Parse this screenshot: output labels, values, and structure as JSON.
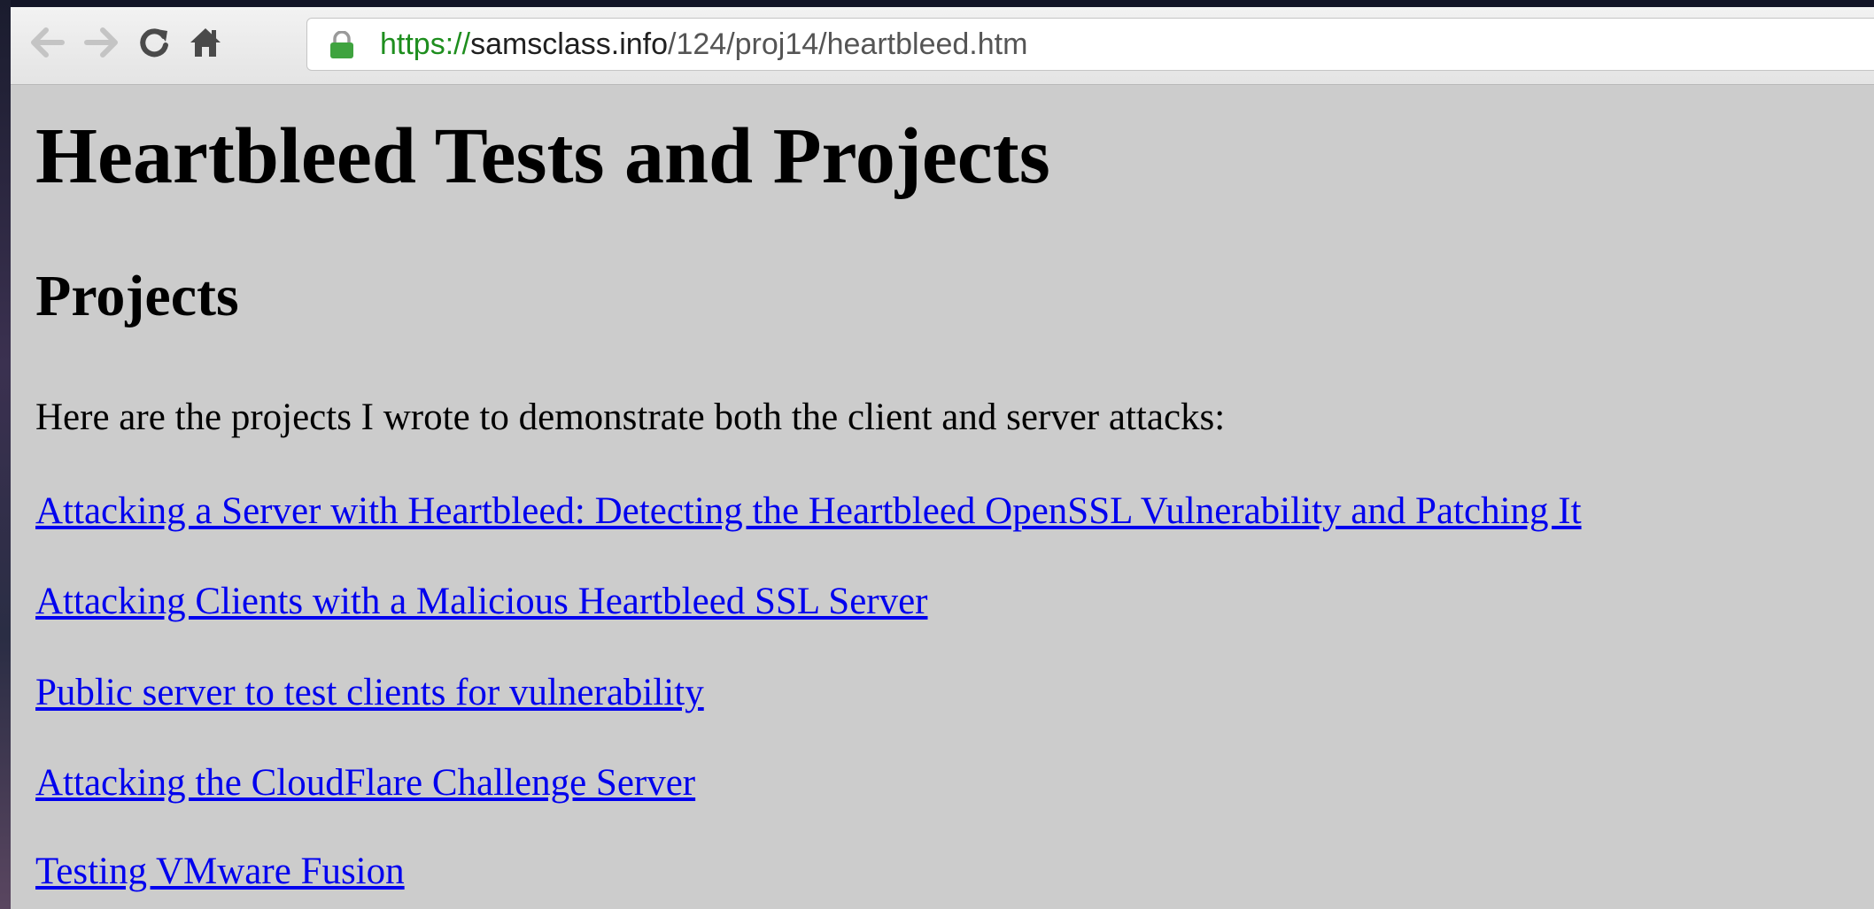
{
  "browser": {
    "url": {
      "scheme": "https",
      "separator": "://",
      "host": "samsclass.info",
      "path": "/124/proj14/heartbleed.htm"
    },
    "icons": {
      "back": "back-arrow-icon",
      "forward": "forward-arrow-icon",
      "reload": "reload-icon",
      "home": "home-icon",
      "secure": "lock-icon"
    },
    "colors": {
      "secure_green": "#1e8e1e",
      "lock_green": "#3fa33f"
    }
  },
  "page": {
    "title": "Heartbleed Tests and Projects",
    "section_heading": "Projects",
    "intro": "Here are the projects I wrote to demonstrate both the client and server attacks:",
    "links": [
      "Attacking a Server with Heartbleed: Detecting the Heartbleed OpenSSL Vulnerability and Patching It",
      "Attacking Clients with a Malicious Heartbleed SSL Server",
      "Public server to test clients for vulnerability",
      "Attacking the CloudFlare Challenge Server",
      "Testing VMware Fusion"
    ],
    "colors": {
      "background": "#cccccc",
      "link": "#0000ee",
      "text": "#000000"
    }
  }
}
